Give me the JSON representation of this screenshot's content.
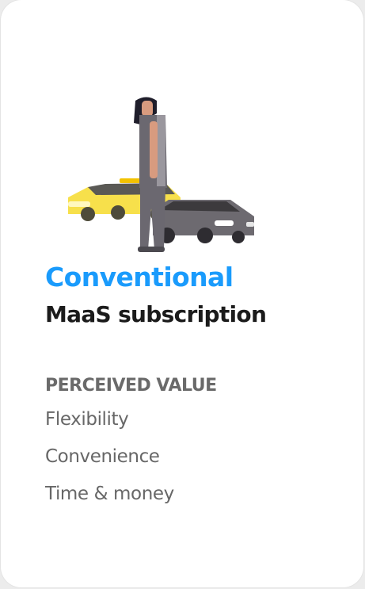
{
  "card": {
    "title": "Conventional",
    "subtitle": "MaaS subscription",
    "value_heading": "PERCEIVED VALUE",
    "values": [
      "Flexibility",
      "Convenience",
      "Time & money"
    ]
  },
  "colors": {
    "accent": "#1a9bfc",
    "heading": "#1b1b1b",
    "muted": "#676767",
    "car_yellow": "#f7e04b",
    "car_grey": "#6d6a70",
    "person": "#6b6870"
  },
  "icons": [
    "person-illustration",
    "yellow-taxi-icon",
    "grey-car-icon"
  ]
}
